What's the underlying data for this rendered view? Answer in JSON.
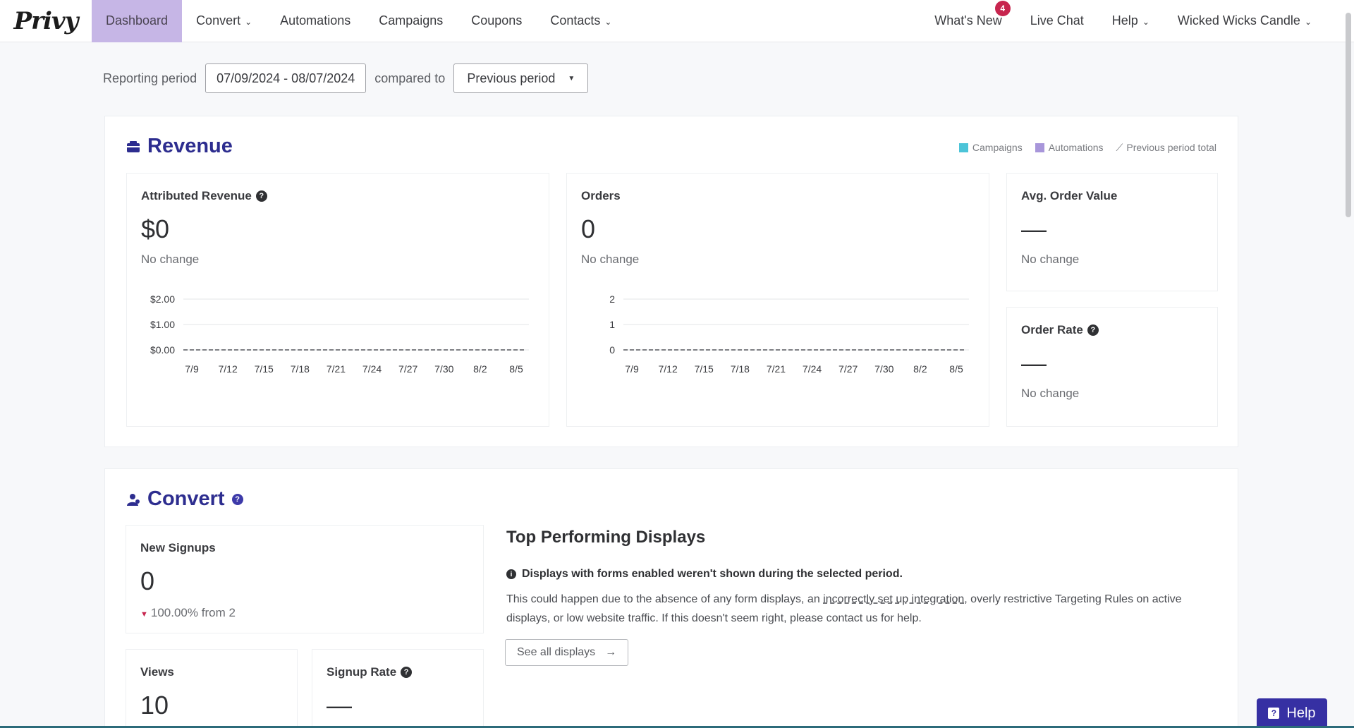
{
  "nav": {
    "logo": "Privy",
    "items": [
      {
        "label": "Dashboard",
        "active": true,
        "caret": false
      },
      {
        "label": "Convert",
        "active": false,
        "caret": true
      },
      {
        "label": "Automations",
        "active": false,
        "caret": false
      },
      {
        "label": "Campaigns",
        "active": false,
        "caret": false
      },
      {
        "label": "Coupons",
        "active": false,
        "caret": false
      },
      {
        "label": "Contacts",
        "active": false,
        "caret": true
      }
    ],
    "right_items": [
      {
        "label": "What's New",
        "badge": "4",
        "caret": false
      },
      {
        "label": "Live Chat",
        "caret": false
      },
      {
        "label": "Help",
        "caret": true
      },
      {
        "label": "Wicked Wicks Candle",
        "caret": true
      }
    ]
  },
  "reporting": {
    "label": "Reporting period",
    "date_range": "07/09/2024 - 08/07/2024",
    "compared_label": "compared to",
    "compare_option": "Previous period"
  },
  "revenue": {
    "title": "Revenue",
    "legend": [
      {
        "label": "Campaigns",
        "color": "#4cc4d8"
      },
      {
        "label": "Automations",
        "color": "#a896da"
      },
      {
        "label": "Previous period total",
        "color": "#9a9ca0"
      }
    ],
    "attributed": {
      "title": "Attributed Revenue",
      "value": "$0",
      "sub": "No change"
    },
    "orders": {
      "title": "Orders",
      "value": "0",
      "sub": "No change"
    },
    "aov": {
      "title": "Avg. Order Value",
      "value": "—",
      "sub": "No change"
    },
    "order_rate": {
      "title": "Order Rate",
      "value": "—",
      "sub": "No change"
    }
  },
  "convert": {
    "title": "Convert",
    "new_signups": {
      "title": "New Signups",
      "value": "0",
      "change": "100.00% from 2"
    },
    "views": {
      "title": "Views",
      "value": "10"
    },
    "signup_rate": {
      "title": "Signup Rate",
      "value": "—"
    },
    "top_displays": {
      "title": "Top Performing Displays",
      "note": "Displays with forms enabled weren't shown during the selected period.",
      "desc_before": "This could happen due to the absence of any form displays, an ",
      "desc_link": "incorrectly set up integration",
      "desc_after": ", overly restrictive Targeting Rules on active displays, or low website traffic. If this doesn't seem right, please contact us for help.",
      "button": "See all displays"
    }
  },
  "help_fab": "Help",
  "chart_data": [
    {
      "type": "line",
      "title": "Attributed Revenue",
      "categories": [
        "7/9",
        "7/12",
        "7/15",
        "7/18",
        "7/21",
        "7/24",
        "7/27",
        "7/30",
        "8/2",
        "8/5"
      ],
      "y_ticks": [
        "$0.00",
        "$1.00",
        "$2.00"
      ],
      "ylim": [
        0,
        2
      ],
      "series": [
        {
          "name": "Campaigns",
          "values": [
            0,
            0,
            0,
            0,
            0,
            0,
            0,
            0,
            0,
            0
          ]
        }
      ]
    },
    {
      "type": "line",
      "title": "Orders",
      "categories": [
        "7/9",
        "7/12",
        "7/15",
        "7/18",
        "7/21",
        "7/24",
        "7/27",
        "7/30",
        "8/2",
        "8/5"
      ],
      "y_ticks": [
        "0",
        "1",
        "2"
      ],
      "ylim": [
        0,
        2
      ],
      "series": [
        {
          "name": "Campaigns",
          "values": [
            0,
            0,
            0,
            0,
            0,
            0,
            0,
            0,
            0,
            0
          ]
        }
      ]
    }
  ]
}
